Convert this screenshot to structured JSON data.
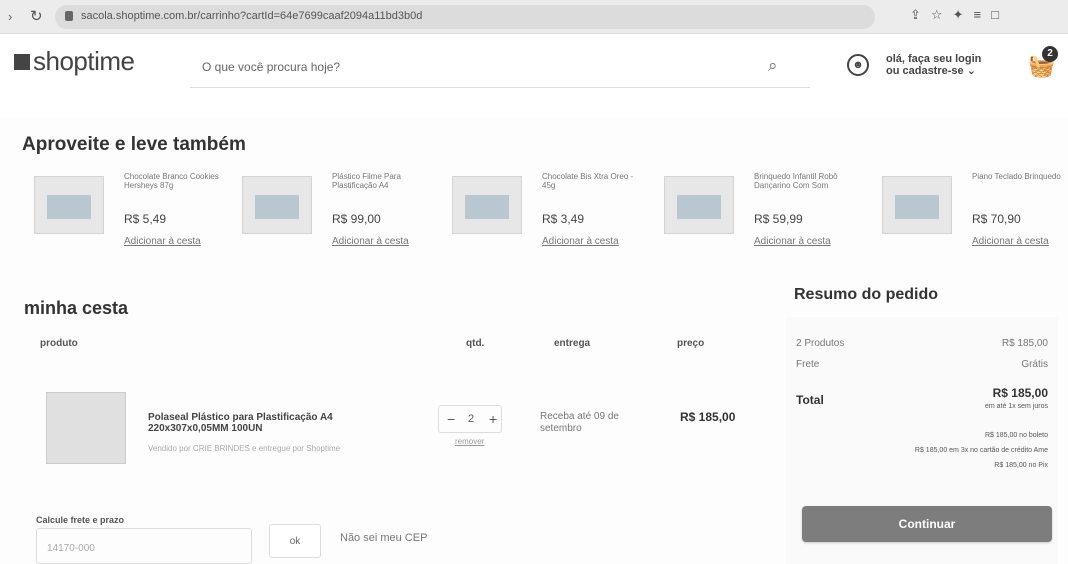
{
  "browser": {
    "url": "sacola.shoptime.com.br/carrinho?cartId=64e7699caaf2094a11bd3b0d",
    "icons": [
      "share-icon",
      "star-icon",
      "pin-icon",
      "menu-icon",
      "window-icon",
      "sidebar-icon"
    ]
  },
  "header": {
    "logo": "shoptime",
    "search_placeholder": "O que você procura hoje?",
    "login": "olá, faça seu login",
    "register": "ou cadastre-se",
    "cart_count": "2"
  },
  "recommendations": {
    "title": "Aproveite e leve também",
    "items": [
      {
        "name": "Chocolate Branco Cookies Hersheys 87g",
        "price": "R$ 5,49",
        "action": "Adicionar à cesta"
      },
      {
        "name": "Plástico Filme Para Plastificação A4",
        "price": "R$ 99,00",
        "action": "Adicionar à cesta"
      },
      {
        "name": "Chocolate Bis Xtra Oreo - 45g",
        "price": "R$ 3,49",
        "action": "Adicionar à cesta"
      },
      {
        "name": "Brinquedo Infantil Robô Dançarino Com Som",
        "price": "R$ 59,99",
        "action": "Adicionar à cesta"
      },
      {
        "name": "Piano Teclado Brinquedo",
        "price": "R$ 70,90",
        "action": "Adicionar à cesta"
      }
    ]
  },
  "cart": {
    "title": "minha cesta",
    "headers": {
      "product": "produto",
      "quantity": "qtd.",
      "delivery": "entrega",
      "price": "preço"
    },
    "product": {
      "name": "Polaseal Plástico para Plastificação A4 220x307x0,05MM 100UN",
      "seller": "Vendido por CRIE BRINDES e entregue por Shoptime",
      "quantity": "2",
      "remove": "remover",
      "delivery": "Receba até 09 de setembro",
      "price": "R$ 185,00"
    }
  },
  "shipping": {
    "label": "Calcule frete e prazo",
    "cep": "14170-000",
    "button": "ok",
    "link": "Não sei meu CEP"
  },
  "summary": {
    "title": "Resumo do pedido",
    "products_label": "2 Produtos",
    "products_value": "R$ 185,00",
    "freight_label": "Frete",
    "freight_value": "Grátis",
    "total_label": "Total",
    "total_value": "R$ 185,00",
    "installments": "em até 1x sem juros",
    "boleto": "R$ 185,00 no boleto",
    "credit": "R$ 185,00 em 3x no cartão de crédito Ame",
    "pix": "R$ 185,00 no Pix",
    "continue": "Continuar"
  }
}
